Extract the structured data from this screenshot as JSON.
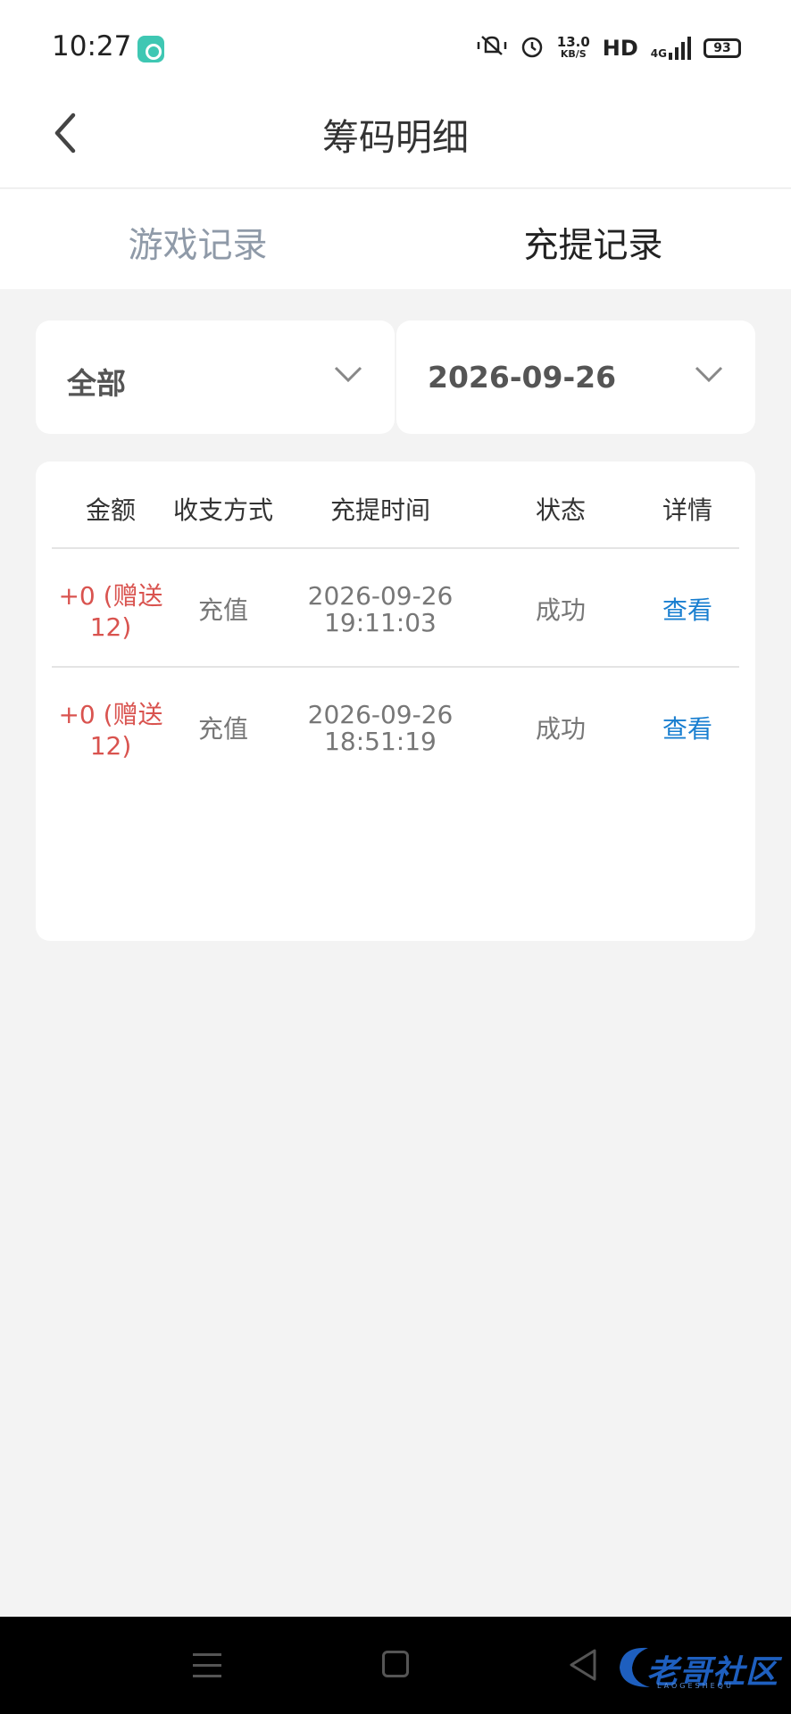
{
  "status_bar": {
    "time": "10:27",
    "speed_value": "13.0",
    "speed_unit": "KB/S",
    "hd": "HD",
    "network": "4G",
    "battery": "93"
  },
  "header": {
    "title": "筹码明细"
  },
  "tabs": [
    {
      "label": "游戏记录",
      "active": false
    },
    {
      "label": "充提记录",
      "active": true
    }
  ],
  "filters": {
    "type": "全部",
    "date": "2026-09-26"
  },
  "table": {
    "columns": [
      "金额",
      "收支方式",
      "充提时间",
      "状态",
      "详情"
    ],
    "rows": [
      {
        "amount_line1": "+0 (赠送",
        "amount_line2": "12)",
        "method": "充值",
        "date": "2026-09-26",
        "time": "19:11:03",
        "status": "成功",
        "detail": "查看"
      },
      {
        "amount_line1": "+0 (赠送",
        "amount_line2": "12)",
        "method": "充值",
        "date": "2026-09-26",
        "time": "18:51:19",
        "status": "成功",
        "detail": "查看"
      }
    ]
  },
  "watermark": {
    "text": "老哥社区",
    "sub": "LAOGESHEQU"
  },
  "colors": {
    "amount": "#d9534f",
    "link": "#1a7fd0",
    "inactive_tab": "#8f9aa8",
    "background": "#f3f3f3"
  }
}
